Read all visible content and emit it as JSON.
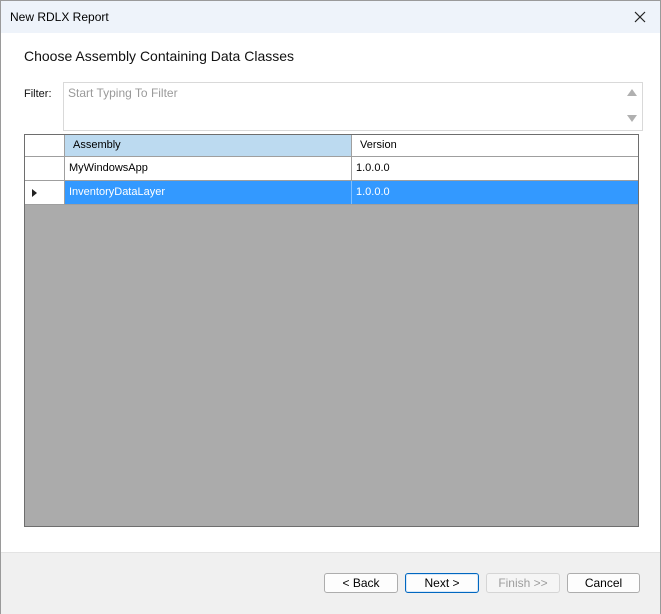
{
  "window": {
    "title": "New RDLX Report"
  },
  "page": {
    "heading": "Choose Assembly Containing Data Classes"
  },
  "filter": {
    "label": "Filter:",
    "placeholder": "Start Typing To Filter",
    "value": ""
  },
  "grid": {
    "columns": [
      "Assembly",
      "Version"
    ],
    "sorted_column": "Assembly",
    "rows": [
      {
        "assembly": "MyWindowsApp",
        "version": "1.0.0.0",
        "selected": false
      },
      {
        "assembly": "InventoryDataLayer",
        "version": "1.0.0.0",
        "selected": true
      }
    ]
  },
  "buttons": {
    "back": "< Back",
    "next": "Next >",
    "finish": "Finish >>",
    "cancel": "Cancel"
  },
  "colors": {
    "selection": "#3399ff",
    "sorted_header": "#bcdaf0",
    "grid_empty_area": "#ababab",
    "titlebar": "#eef3fa"
  }
}
